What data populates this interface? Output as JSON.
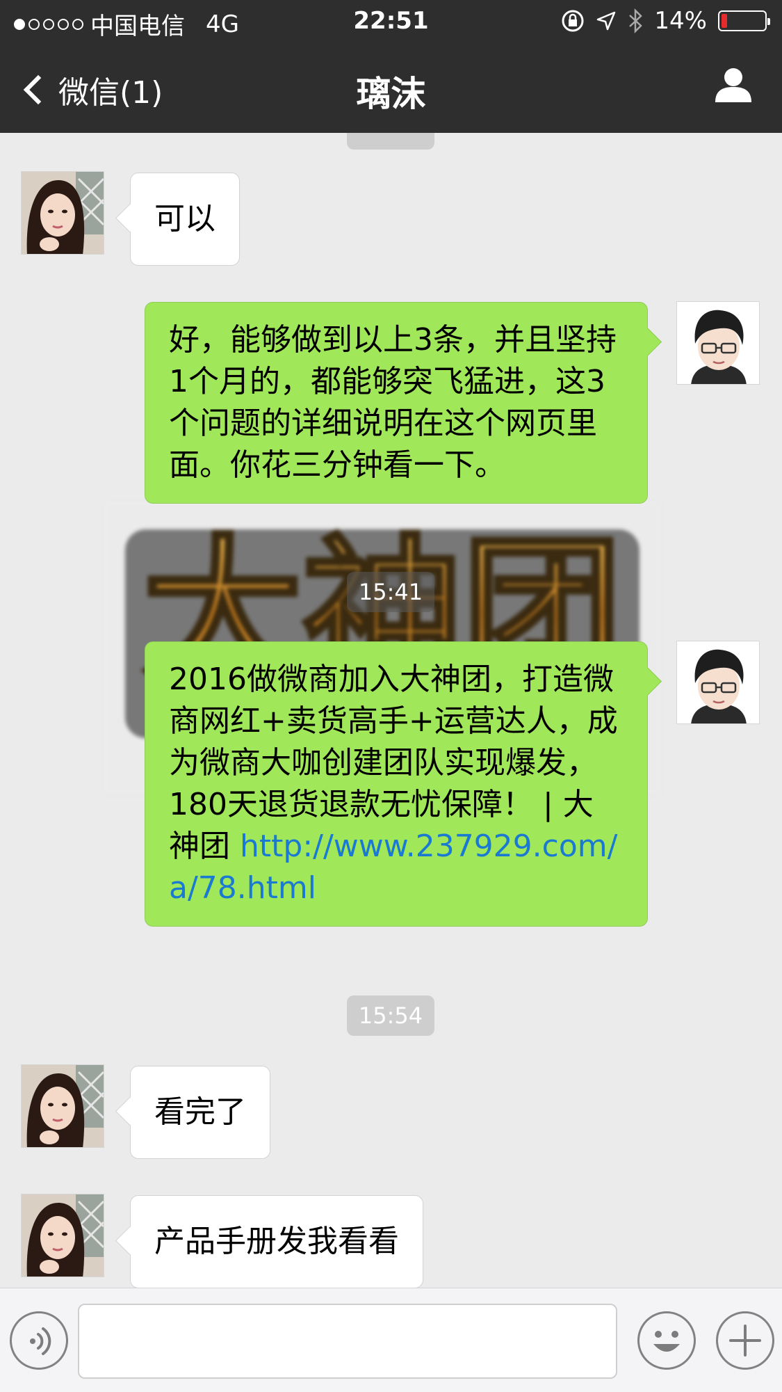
{
  "status_bar": {
    "carrier": "中国电信",
    "network": "4G",
    "time": "22:51",
    "battery_percent": "14%",
    "battery_level": 0.14,
    "icons": [
      "lock-rotation-icon",
      "location-arrow-icon",
      "bluetooth-icon",
      "battery-icon"
    ]
  },
  "nav": {
    "back_label": "微信(1)",
    "title": "璃沫",
    "profile_icon": "person-icon"
  },
  "messages": {
    "m1": {
      "sender": "contact",
      "text": "可以"
    },
    "m2": {
      "sender": "me",
      "text": "好，能够做到以上3条，并且坚持1个月的，都能够突飞猛进，这3个问题的详细说明在这个网页里面。你花三分钟看一下。"
    },
    "time1": "15:41",
    "m3": {
      "sender": "me",
      "text": "2016做微商加入大神团，打造微商网红+卖货高手+运营达人，成为微商大咖创建团队实现爆发，180天退货退款无忧保障！ | 大神团 ",
      "link": "http://www.237929.com/a/78.html"
    },
    "time2": "15:54",
    "m4": {
      "sender": "contact",
      "text": "看完了"
    },
    "m5": {
      "sender": "contact",
      "text": "产品手册发我看看"
    }
  },
  "background_banner_text": "大神团",
  "input_bar": {
    "voice_icon": "voice-icon",
    "emoji_icon": "emoji-icon",
    "plus_icon": "plus-icon"
  },
  "colors": {
    "bar_bg": "#2e2e2f",
    "chat_bg": "#ebebeb",
    "outgoing_bubble": "#a0e759",
    "incoming_bubble": "#ffffff",
    "link": "#1a79d1",
    "battery_low": "#e52b2b"
  }
}
